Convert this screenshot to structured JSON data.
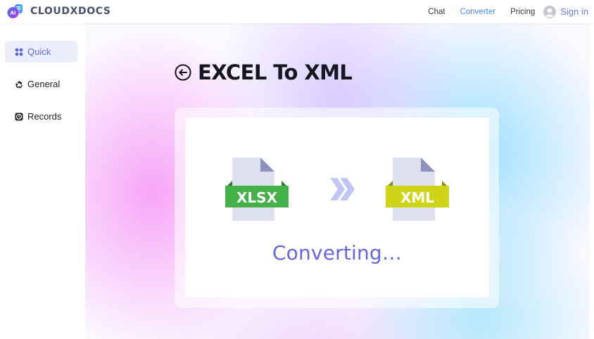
{
  "header": {
    "brand": "CLOUDXDOCS",
    "logo_badge": "AI",
    "nav": [
      {
        "label": "Chat",
        "active": false
      },
      {
        "label": "Converter",
        "active": true
      },
      {
        "label": "Pricing",
        "active": false
      }
    ],
    "signin_label": "Sign in"
  },
  "sidebar": {
    "items": [
      {
        "label": "Quick",
        "icon": "grid-icon",
        "active": true
      },
      {
        "label": "General",
        "icon": "recycle-icon",
        "active": false
      },
      {
        "label": "Records",
        "icon": "history-icon",
        "active": false
      }
    ]
  },
  "main": {
    "title": "EXCEL To XML",
    "source_format": "XLSX",
    "target_format": "XML",
    "status": "Converting…"
  },
  "colors": {
    "accent": "#6366e8",
    "nav_active": "#3a8ee8",
    "xlsx_band": "#44b148",
    "xml_band": "#cfd516",
    "file_body": "#dfe0ee",
    "file_fold": "#8c92bd"
  }
}
